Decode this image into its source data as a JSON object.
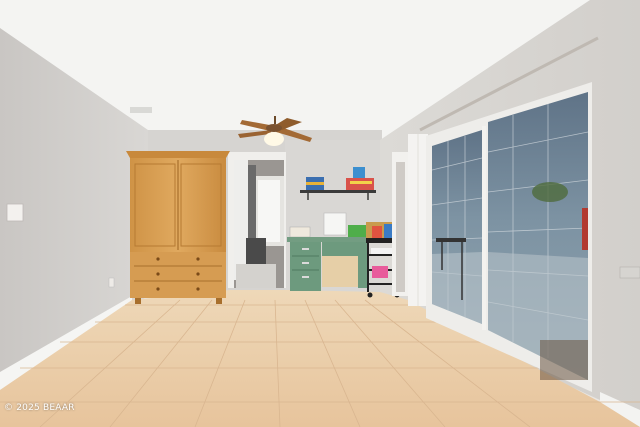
{
  "photo": {
    "watermark": "© 2025 BEAAR",
    "objects": [
      "ceiling-fan",
      "wardrobe-armoire",
      "green-desk",
      "wall-shelf-with-books",
      "rolling-storage-cart",
      "sliding-glass-doors",
      "tile-floor",
      "doorway-to-laundry"
    ],
    "colors": {
      "wall": "#d8d6d3",
      "ceiling": "#f4f4f2",
      "floor": "#e8c9a3",
      "wood": "#d9a25a",
      "desk": "#6d9a7e"
    }
  }
}
